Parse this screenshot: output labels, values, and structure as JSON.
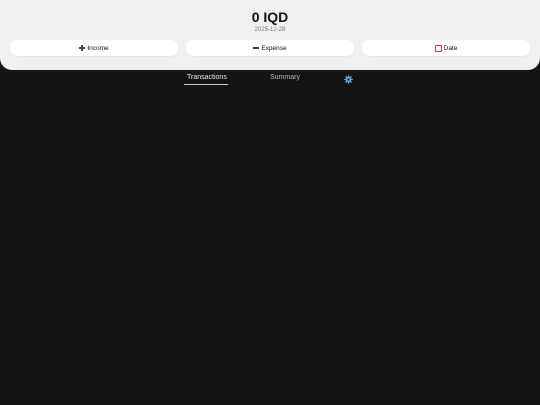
{
  "header": {
    "balance": "0 IQD",
    "date": "2025-12-28"
  },
  "actions": {
    "income_label": "Income",
    "expense_label": "Expense",
    "date_label": "Date"
  },
  "tabs": [
    {
      "label": "Transactions",
      "active": true
    },
    {
      "label": "Summary",
      "active": false
    }
  ],
  "icons": {
    "income": "plus-icon",
    "expense": "minus-icon",
    "date": "calendar-icon",
    "settings": "gear-icon"
  },
  "colors": {
    "background": "#141414",
    "header": "#f0f0f0",
    "gear": "#6aa9d8"
  }
}
